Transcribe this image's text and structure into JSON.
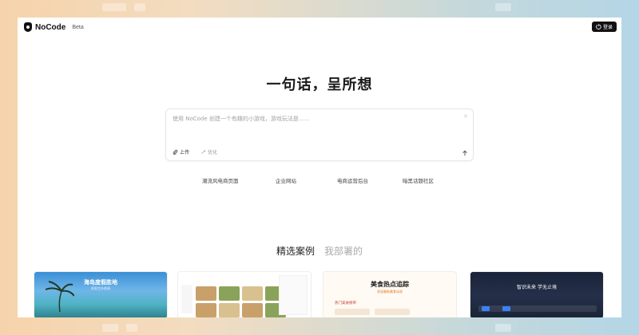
{
  "header": {
    "logo_text": "NoCode",
    "badge": "Beta",
    "login_label": "登录"
  },
  "hero": {
    "title": "一句话，呈所想"
  },
  "prompt": {
    "placeholder": "使用 NoCode 创建一个有趣的小游戏，游戏玩法是......",
    "upload_label": "上传",
    "optimize_label": "优化"
  },
  "suggestions": [
    "潮流风电商页面",
    "企业网站",
    "电商运营后台",
    "暗黑话题社区"
  ],
  "tabs": [
    {
      "label": "精选案例",
      "active": true
    },
    {
      "label": "我部署的",
      "active": false
    }
  ],
  "cards": {
    "card1_title": "海岛度假胜地",
    "card1_sub": "探索世外桃源",
    "card3_title": "美食热点追踪",
    "card3_sub": "发现最新美食动态",
    "card3_list_head": "热门美食榜单",
    "card4_title": "智识未来 学无止境"
  },
  "colors": {
    "accent_dark": "#111111",
    "send_arrow": "#555555"
  }
}
